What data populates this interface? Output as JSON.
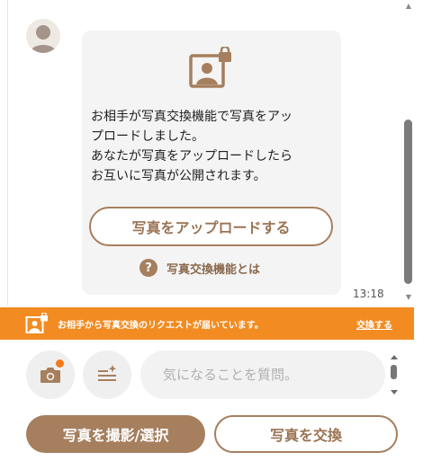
{
  "chat": {
    "message_lines": [
      "お相手が写真交換機能で写真をアッ",
      "プロードしました。",
      "あなたが写真をアップロードしたら",
      "お互いに写真が公開されます。"
    ],
    "upload_button_label": "写真をアップロードする",
    "about_label": "写真交換機能とは",
    "about_icon_glyph": "?",
    "timestamp": "13:18"
  },
  "banner": {
    "text": "お相手から写真交換のリクエストが届いています。",
    "link_label": "交換する",
    "color": "#f28c22"
  },
  "composer": {
    "placeholder": "気になることを質問。",
    "camera_icon": "camera-icon",
    "template_icon": "template-list-icon"
  },
  "actions": {
    "primary_label": "写真を撮影/選択",
    "secondary_label": "写真を交換"
  },
  "colors": {
    "brand_brown": "#a67f5e",
    "accent_orange": "#f28c22"
  }
}
